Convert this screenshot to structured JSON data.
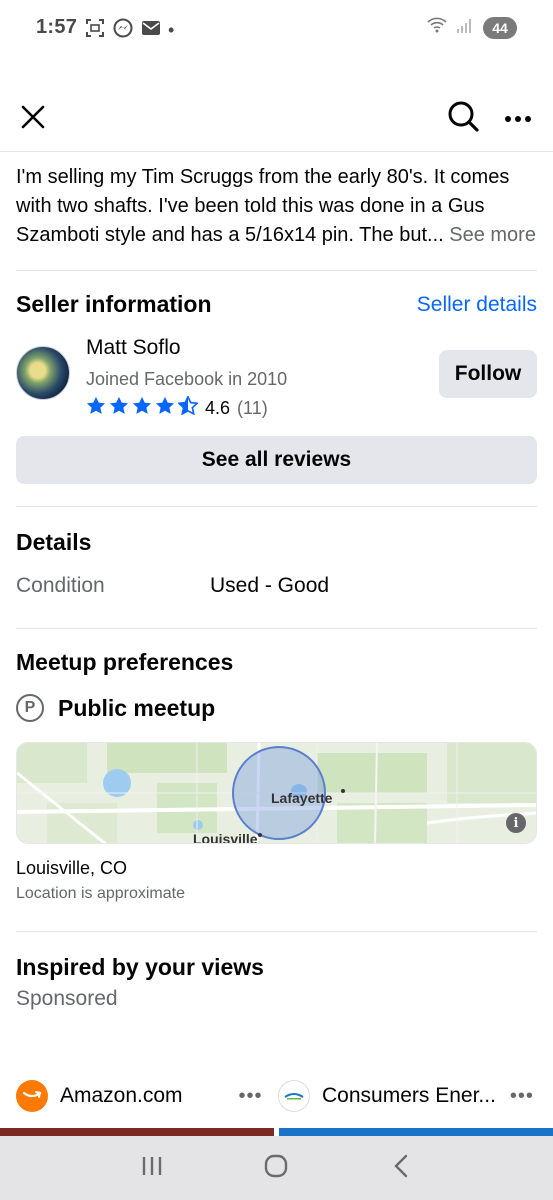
{
  "status_bar": {
    "time": "1:57",
    "dot": "•",
    "battery": "44",
    "icons": [
      "screenshot-icon",
      "messenger-icon",
      "mail-icon",
      "wifi-icon",
      "signal-icon"
    ]
  },
  "top_bar": {
    "icons": [
      "close-icon",
      "search-icon",
      "more-icon"
    ]
  },
  "description": {
    "text": "I'm selling my Tim Scruggs from the early 80's. It comes with two shafts. I've been told this was done in a Gus Szamboti style and has a 5/16x14 pin. The but...",
    "see_more": "See more"
  },
  "seller_info": {
    "title": "Seller information",
    "details_link": "Seller details",
    "name": "Matt Soflo",
    "joined": "Joined Facebook in 2010",
    "rating": "4.6",
    "rating_count": "(11)",
    "stars": 4.5,
    "follow_label": "Follow",
    "reviews_label": "See all reviews"
  },
  "details": {
    "title": "Details",
    "condition_label": "Condition",
    "condition_value": "Used - Good"
  },
  "meetup": {
    "title": "Meetup preferences",
    "icon_letter": "P",
    "type": "Public meetup",
    "map_label_1": "Lafayette",
    "map_label_2": "Louisville",
    "info_glyph": "i",
    "location": "Louisville, CO",
    "location_note": "Location is approximate"
  },
  "inspired": {
    "title": "Inspired by your views",
    "sponsored": "Sponsored",
    "ads": [
      {
        "name": "Amazon.com",
        "more": "•••"
      },
      {
        "name": "Consumers Ener...",
        "more": "•••"
      }
    ]
  },
  "colors": {
    "accent": "#0866ff",
    "secondary_text": "#65676b",
    "button_bg": "#e4e6eb"
  }
}
